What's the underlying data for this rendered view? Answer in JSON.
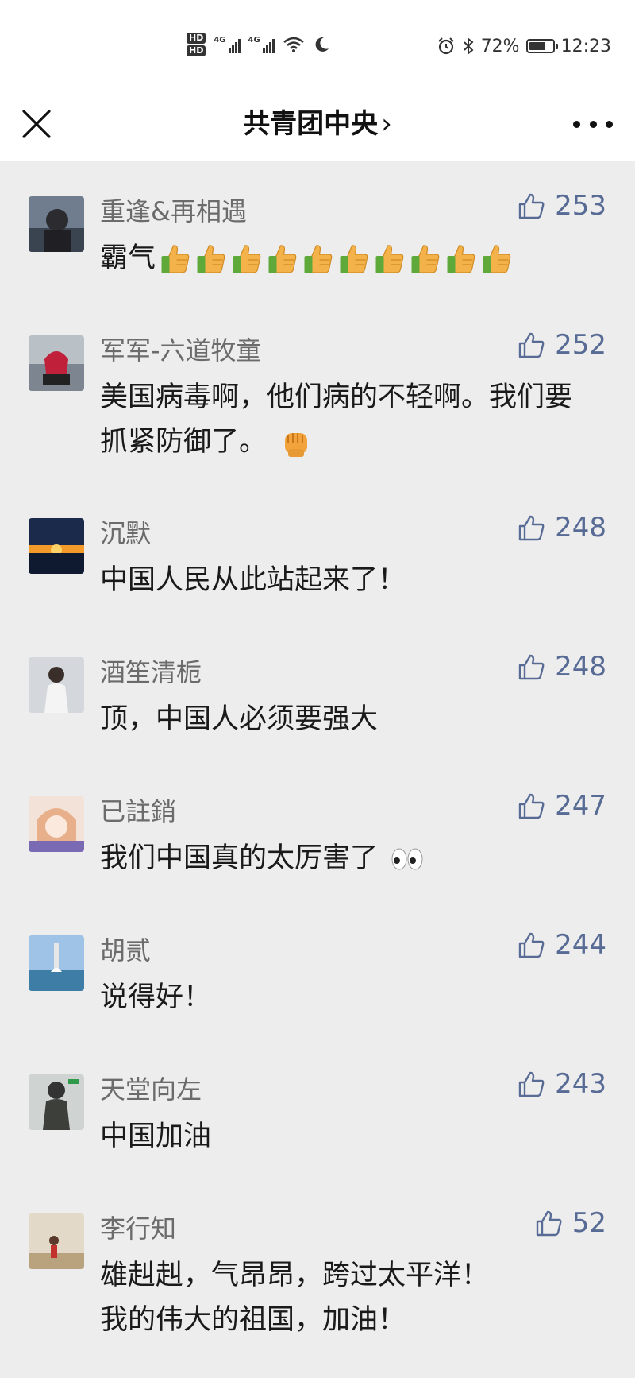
{
  "status": {
    "hd1": "HD",
    "hd2": "HD",
    "sig1": "4G",
    "sig2": "4G",
    "battery_percent": "72%",
    "battery_level": 0.72,
    "time": "12:23",
    "icons": [
      "alarm-icon",
      "bluetooth-icon",
      "wifi-icon",
      "moon-icon"
    ]
  },
  "header": {
    "title": "共青团中央",
    "chevron": "›"
  },
  "comments": [
    {
      "name": "重逢&再相遇",
      "likes": "253",
      "text": "霸气",
      "emoji": "thumbs-up-icon",
      "emoji_count": 10
    },
    {
      "name": "军军-六道牧童",
      "likes": "252",
      "text": "美国病毒啊，他们病的不轻啊。我们要抓紧防御了。",
      "emoji": "raised-fist-icon"
    },
    {
      "name": "沉默",
      "likes": "248",
      "text": "中国人民从此站起来了！"
    },
    {
      "name": "酒笙清栀",
      "likes": "248",
      "text": "顶，中国人必须要强大"
    },
    {
      "name": "已註銷",
      "likes": "247",
      "text": "我们中国真的太厉害了",
      "emoji": "eyes-icon"
    },
    {
      "name": "胡贰",
      "likes": "244",
      "text": "说得好！"
    },
    {
      "name": "天堂向左",
      "likes": "243",
      "text": "中国加油"
    },
    {
      "name": "李行知",
      "likes": "52",
      "text": "雄赳赳，气昂昂，跨过太平洋！我的伟大的祖国，加油！"
    }
  ],
  "colors": {
    "like_blue": "#576b95",
    "name_gray": "#6b6b6b",
    "background": "#ededed"
  }
}
